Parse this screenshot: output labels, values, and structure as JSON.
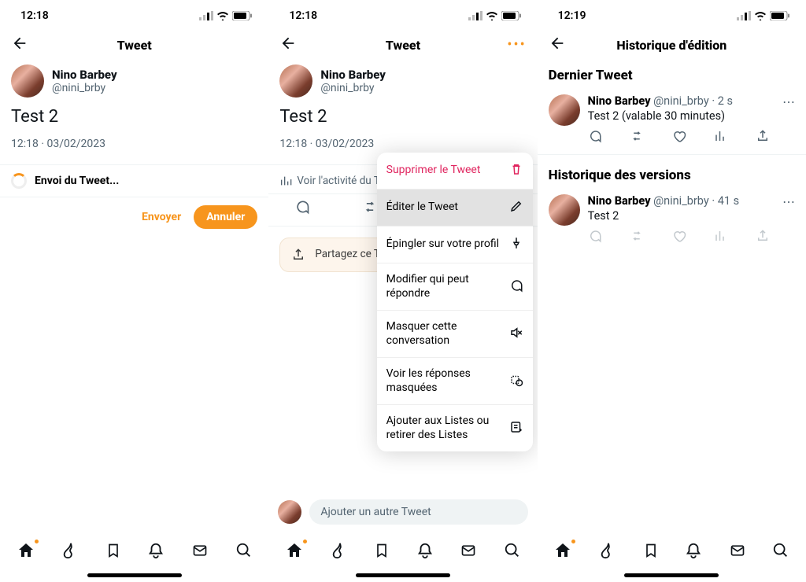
{
  "screens": {
    "left": {
      "time": "12:18",
      "header_title": "Tweet",
      "user": {
        "name": "Nino Barbey",
        "handle": "@nini_brby"
      },
      "tweet_text": "Test 2",
      "tweet_meta": "12:18 · 03/02/2023",
      "sending_label": "Envoi du Tweet...",
      "btn_send": "Envoyer",
      "btn_cancel": "Annuler"
    },
    "middle": {
      "time": "12:18",
      "header_title": "Tweet",
      "user": {
        "name": "Nino Barbey",
        "handle": "@nini_brby"
      },
      "tweet_text": "Test 2",
      "tweet_meta": "12:18 · 03/02/2023",
      "activity_label": "Voir l'activité du Tw",
      "share_text": "Partagez ce Tweet choix, même si Twitter.",
      "compose_placeholder": "Ajouter un autre Tweet",
      "menu": {
        "delete": "Supprimer le Tweet",
        "edit": "Éditer le Tweet",
        "pin": "Épingler sur votre profil",
        "who": "Modifier qui peut répondre",
        "hide_conv": "Masquer cette conversation",
        "hidden_replies": "Voir les réponses masquées",
        "lists": "Ajouter aux Listes ou retirer des Listes"
      }
    },
    "right": {
      "time": "12:19",
      "header_title": "Historique d'édition",
      "section_latest": "Dernier Tweet",
      "section_versions": "Historique des versions",
      "latest": {
        "name": "Nino Barbey",
        "handle": "@nini_brby",
        "age": "2 s",
        "body": "Test 2 (valable 30 minutes)"
      },
      "version": {
        "name": "Nino Barbey",
        "handle": "@nini_brby",
        "age": "41 s",
        "body": "Test 2"
      }
    }
  }
}
